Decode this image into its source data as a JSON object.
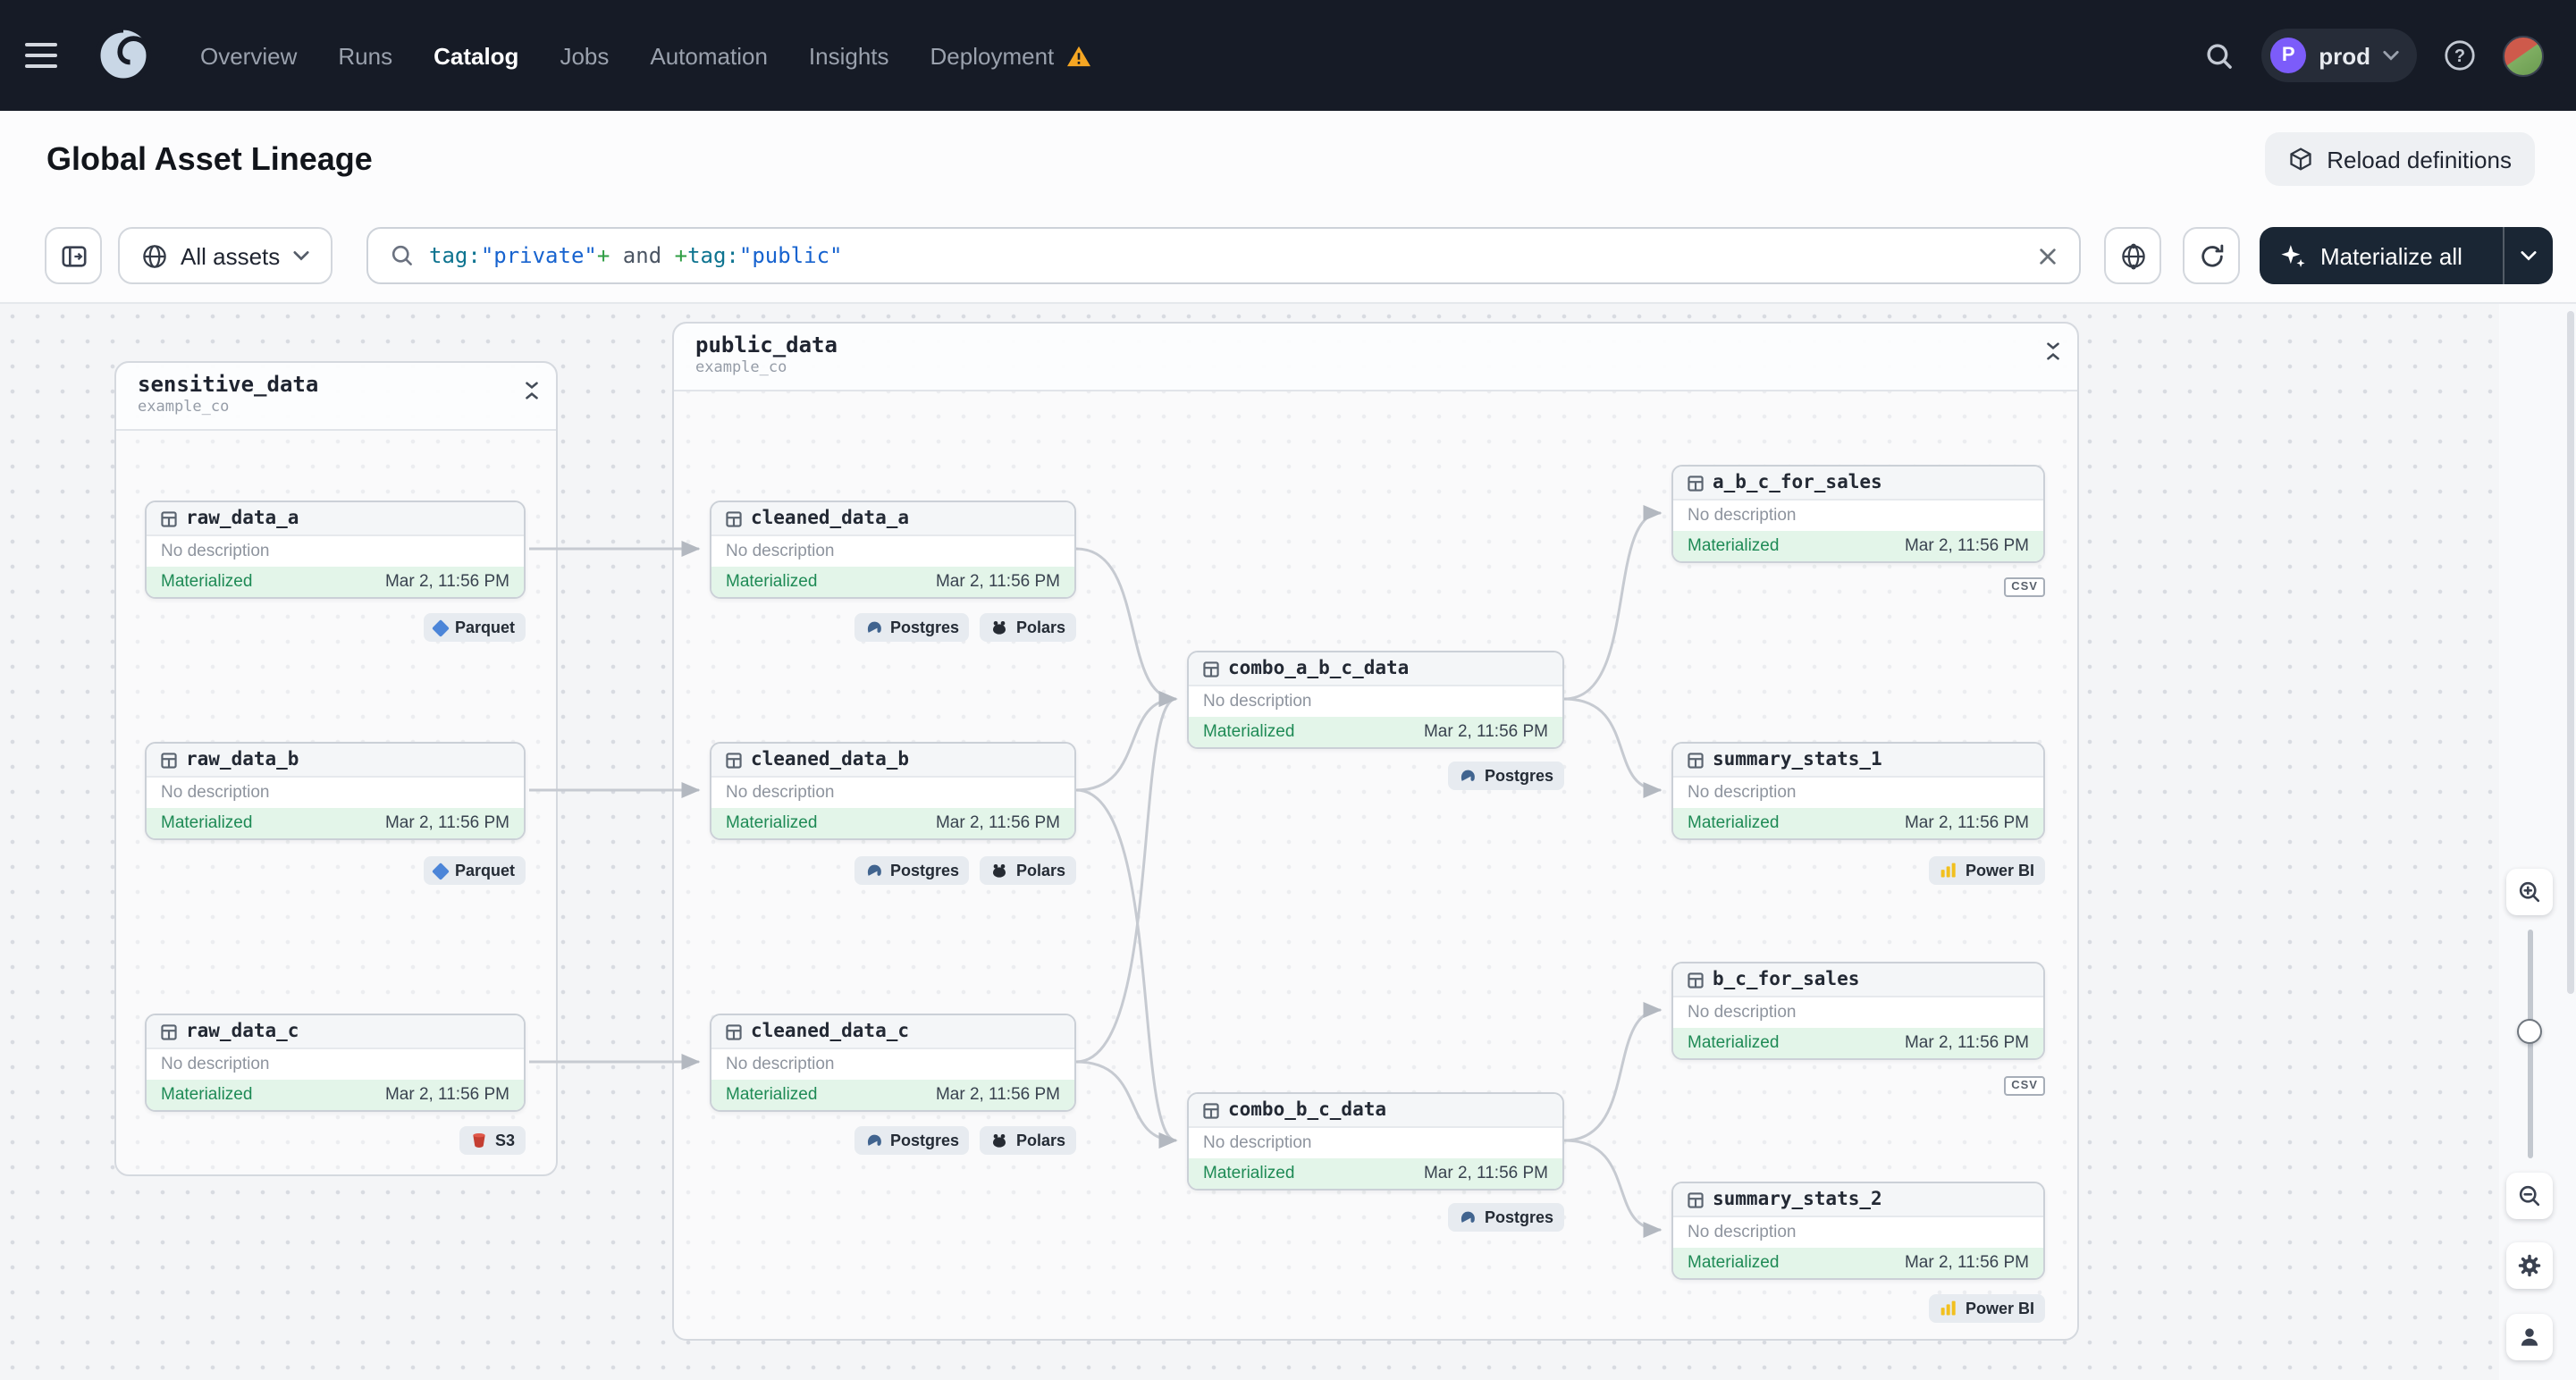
{
  "navbar": {
    "nav_items": [
      "Overview",
      "Runs",
      "Catalog",
      "Jobs",
      "Automation",
      "Insights",
      "Deployment"
    ],
    "active_item": "Catalog",
    "user_env": {
      "initial": "P",
      "name": "prod"
    }
  },
  "page": {
    "title": "Global Asset Lineage",
    "reload_button": "Reload definitions"
  },
  "toolbar": {
    "scope": "All assets",
    "query": {
      "k1": "tag:",
      "v1": "\"private\"",
      "p1": "+",
      "op": " and ",
      "p2": "+",
      "k2": "tag:",
      "v2": "\"public\""
    },
    "materialize": "Materialize all"
  },
  "groups": [
    {
      "name": "sensitive_data",
      "org": "example_co"
    },
    {
      "name": "public_data",
      "org": "example_co"
    }
  ],
  "nodes": [
    {
      "name": "raw_data_a",
      "description": "No description",
      "status": "Materialized",
      "time": "Mar 2, 11:56 PM",
      "kinds": [
        "Parquet"
      ]
    },
    {
      "name": "raw_data_b",
      "description": "No description",
      "status": "Materialized",
      "time": "Mar 2, 11:56 PM",
      "kinds": [
        "Parquet"
      ]
    },
    {
      "name": "raw_data_c",
      "description": "No description",
      "status": "Materialized",
      "time": "Mar 2, 11:56 PM",
      "kinds": [
        "S3"
      ]
    },
    {
      "name": "cleaned_data_a",
      "description": "No description",
      "status": "Materialized",
      "time": "Mar 2, 11:56 PM",
      "kinds": [
        "Postgres",
        "Polars"
      ]
    },
    {
      "name": "cleaned_data_b",
      "description": "No description",
      "status": "Materialized",
      "time": "Mar 2, 11:56 PM",
      "kinds": [
        "Postgres",
        "Polars"
      ]
    },
    {
      "name": "cleaned_data_c",
      "description": "No description",
      "status": "Materialized",
      "time": "Mar 2, 11:56 PM",
      "kinds": [
        "Postgres",
        "Polars"
      ]
    },
    {
      "name": "combo_a_b_c_data",
      "description": "No description",
      "status": "Materialized",
      "time": "Mar 2, 11:56 PM",
      "kinds": [
        "Postgres"
      ]
    },
    {
      "name": "combo_b_c_data",
      "description": "No description",
      "status": "Materialized",
      "time": "Mar 2, 11:56 PM",
      "kinds": [
        "Postgres"
      ]
    },
    {
      "name": "a_b_c_for_sales",
      "description": "No description",
      "status": "Materialized",
      "time": "Mar 2, 11:56 PM",
      "kinds": [
        "CSV"
      ]
    },
    {
      "name": "summary_stats_1",
      "description": "No description",
      "status": "Materialized",
      "time": "Mar 2, 11:56 PM",
      "kinds": [
        "Power BI"
      ]
    },
    {
      "name": "b_c_for_sales",
      "description": "No description",
      "status": "Materialized",
      "time": "Mar 2, 11:56 PM",
      "kinds": [
        "CSV"
      ]
    },
    {
      "name": "summary_stats_2",
      "description": "No description",
      "status": "Materialized",
      "time": "Mar 2, 11:56 PM",
      "kinds": [
        "Power BI"
      ]
    }
  ],
  "colors": {
    "navbar": "#161B26",
    "materialized_bg": "#E3F5E9",
    "materialized_text": "#1E8A55",
    "warning": "#F5A623",
    "primary_button": "#1A2634"
  }
}
